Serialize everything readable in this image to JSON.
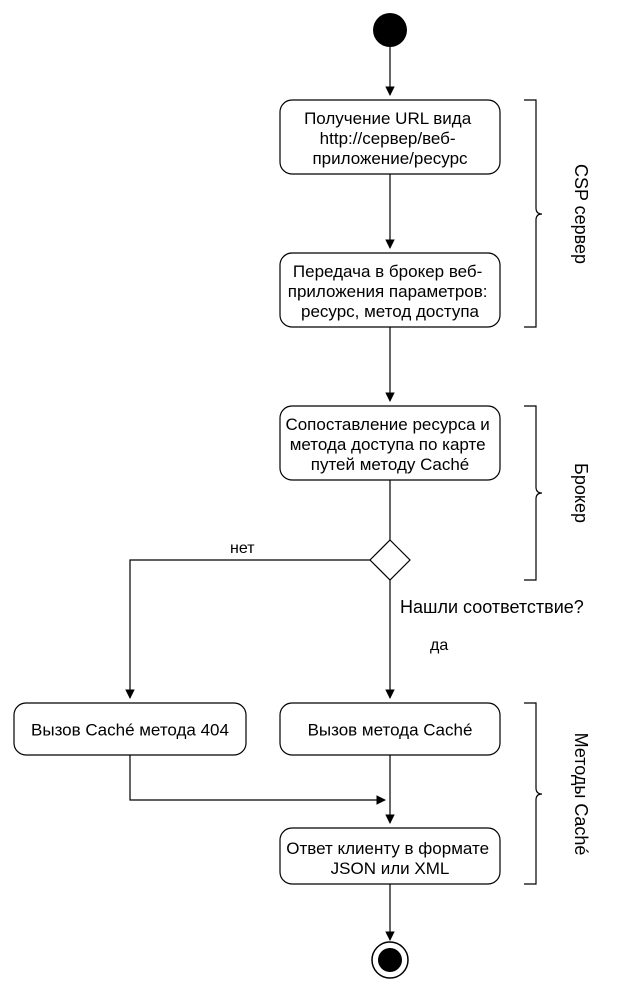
{
  "chart_data": {
    "type": "flowchart",
    "nodes": [
      {
        "id": "start",
        "kind": "initial"
      },
      {
        "id": "n1",
        "kind": "activity",
        "lines": [
          "Получение URL вида",
          "http://сервер/веб-",
          "приложение/ресурс"
        ]
      },
      {
        "id": "n2",
        "kind": "activity",
        "lines": [
          "Передача в брокер веб-",
          "приложения параметров:",
          "ресурс, метод доступа"
        ]
      },
      {
        "id": "n3",
        "kind": "activity",
        "lines": [
          "Сопоставление ресурса и",
          "метода доступа по карте",
          "путей методу Caché"
        ]
      },
      {
        "id": "d1",
        "kind": "decision",
        "question": "Нашли соответствие?",
        "yes": "да",
        "no": "нет"
      },
      {
        "id": "n4",
        "kind": "activity",
        "lines": [
          "Вызов Caché метода 404"
        ]
      },
      {
        "id": "n5",
        "kind": "activity",
        "lines": [
          "Вызов метода Caché"
        ]
      },
      {
        "id": "n6",
        "kind": "activity",
        "lines": [
          "Ответ клиенту в формате",
          "JSON или XML"
        ]
      },
      {
        "id": "end",
        "kind": "final"
      }
    ],
    "edges": [
      {
        "from": "start",
        "to": "n1"
      },
      {
        "from": "n1",
        "to": "n2"
      },
      {
        "from": "n2",
        "to": "n3"
      },
      {
        "from": "n3",
        "to": "d1"
      },
      {
        "from": "d1",
        "to": "n4",
        "label": "нет"
      },
      {
        "from": "d1",
        "to": "n5",
        "label": "да"
      },
      {
        "from": "n4",
        "to": "n6"
      },
      {
        "from": "n5",
        "to": "n6"
      },
      {
        "from": "n6",
        "to": "end"
      }
    ],
    "groups": [
      {
        "label": "CSP сервер",
        "members": [
          "n1",
          "n2"
        ]
      },
      {
        "label": "Брокер",
        "members": [
          "n3",
          "d1"
        ]
      },
      {
        "label": "Методы Caché",
        "members": [
          "n4",
          "n5",
          "n6"
        ]
      }
    ]
  }
}
